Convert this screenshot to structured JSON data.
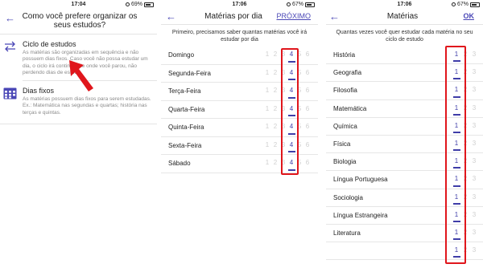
{
  "screens": [
    {
      "status": {
        "time": "17:04",
        "battery": "69%",
        "battery_level": 0.69
      },
      "title": "Como você prefere organizar os seus estudos?",
      "options": [
        {
          "title": "Ciclo de estudos",
          "icon": "cycle-arrows-icon",
          "description": "As matérias são organizadas em sequência e não possuem dias fixos. Caso você não possa estudar um dia, o ciclo irá continuar de onde você parou, não perdendo dias de estudo."
        },
        {
          "title": "Dias fixos",
          "icon": "calendar-grid-icon",
          "description": "As matérias possuem dias fixos para serem estudadas. Ex.: Matemática nas segundas e quartas; história nas terças e quintas."
        }
      ]
    },
    {
      "status": {
        "time": "17:06",
        "battery": "67%",
        "battery_level": 0.67
      },
      "title": "Matérias por dia",
      "action": "PRÓXIMO",
      "subtitle": "Primeiro, precisamos saber quantas matérias você irá estudar por dia",
      "scale": [
        "1",
        "2",
        "3",
        "4",
        "5",
        "6"
      ],
      "rows": [
        {
          "label": "Domingo",
          "selected": "4"
        },
        {
          "label": "Segunda-Feira",
          "selected": "4"
        },
        {
          "label": "Terça-Feira",
          "selected": "4"
        },
        {
          "label": "Quarta-Feira",
          "selected": "4"
        },
        {
          "label": "Quinta-Feira",
          "selected": "4"
        },
        {
          "label": "Sexta-Feira",
          "selected": "4"
        },
        {
          "label": "Sábado",
          "selected": "4"
        }
      ]
    },
    {
      "status": {
        "time": "17:06",
        "battery": "67%",
        "battery_level": 0.67
      },
      "title": "Matérias",
      "action": "OK",
      "subtitle": "Quantas vezes você quer estudar cada matéria no seu ciclo de estudo",
      "scale": [
        "1",
        "2",
        "3"
      ],
      "rows": [
        {
          "label": "História",
          "selected": "1"
        },
        {
          "label": "Geografia",
          "selected": "1"
        },
        {
          "label": "Filosofia",
          "selected": "1"
        },
        {
          "label": "Matemática",
          "selected": "1"
        },
        {
          "label": "Química",
          "selected": "1"
        },
        {
          "label": "Física",
          "selected": "1"
        },
        {
          "label": "Biologia",
          "selected": "1"
        },
        {
          "label": "Língua Portuguesa",
          "selected": "1"
        },
        {
          "label": "Sociologia",
          "selected": "1"
        },
        {
          "label": "Língua Estrangeira",
          "selected": "1"
        },
        {
          "label": "Literatura",
          "selected": "1"
        },
        {
          "label": "",
          "selected": "1"
        }
      ]
    }
  ],
  "colors": {
    "accent": "#4a47b6",
    "highlight": "#e0161c",
    "muted": "#8a8a8a"
  }
}
